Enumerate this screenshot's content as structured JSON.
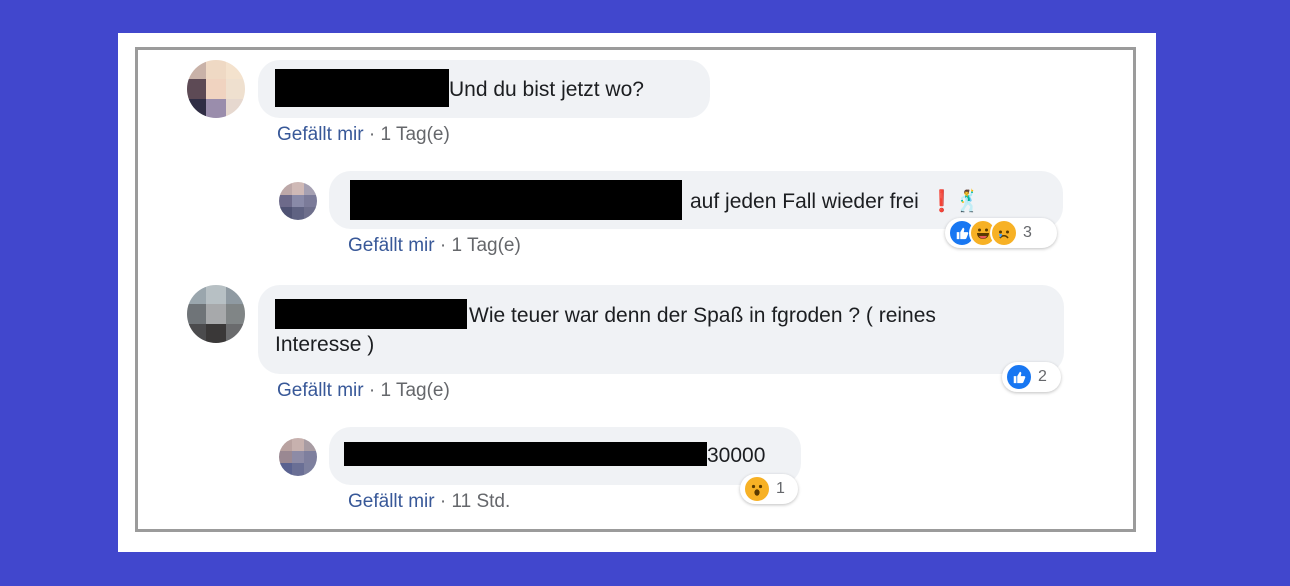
{
  "comments": [
    {
      "text": "Und du bist jetzt wo?",
      "like_label": "Gefällt mir",
      "separator": "·",
      "time": "1 Tag(e)"
    },
    {
      "text": "auf jeden Fall wieder frei",
      "emoji": "❗🕺",
      "like_label": "Gefällt mir",
      "separator": "·",
      "time": "1 Tag(e)",
      "reaction_icons": [
        "like-icon",
        "haha-icon",
        "sad-icon"
      ],
      "reaction_count": "3"
    },
    {
      "text_line1": "Wie teuer war denn der Spaß in fgroden ? ( reines",
      "text_line2": "Interesse )",
      "like_label": "Gefällt mir",
      "separator": "·",
      "time": "1 Tag(e)",
      "reaction_icons": [
        "like-icon"
      ],
      "reaction_count": "2"
    },
    {
      "text": "30000",
      "like_label": "Gefällt mir",
      "separator": "·",
      "time": "11 Std.",
      "reaction_icons": [
        "wow-icon"
      ],
      "reaction_count": "1"
    }
  ],
  "colors": {
    "background": "#4147cd",
    "bubble": "#f0f2f5",
    "like_link": "#385898",
    "meta_text": "#65676b",
    "like_reaction": "#1877f2",
    "emoji_reaction": "#f7b125"
  }
}
